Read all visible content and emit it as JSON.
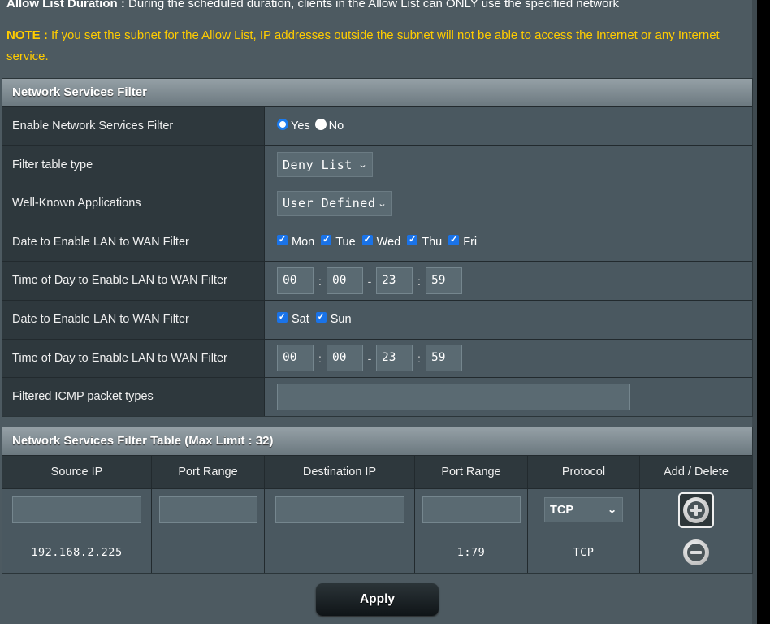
{
  "intro": {
    "allow_list_label": "Allow List Duration :",
    "allow_list_text": " During the scheduled duration, clients in the Allow List can ONLY use the specified network",
    "note_label": "NOTE :",
    "note_text": " If you set the subnet for the Allow List, IP addresses outside the subnet will not be able to access the Internet or any Internet service."
  },
  "filter": {
    "title": "Network Services Filter",
    "enable": {
      "label": "Enable Network Services Filter",
      "yes": "Yes",
      "no": "No",
      "selected": "Yes"
    },
    "table_type": {
      "label": "Filter table type",
      "value": "Deny List"
    },
    "well_known": {
      "label": "Well-Known Applications",
      "value": "User Defined"
    },
    "weekday_date": {
      "label": "Date to Enable LAN to WAN Filter",
      "days": [
        "Mon",
        "Tue",
        "Wed",
        "Thu",
        "Fri"
      ],
      "checked": [
        true,
        true,
        true,
        true,
        true
      ]
    },
    "weekday_time": {
      "label": "Time of Day to Enable LAN to WAN Filter",
      "start_h": "00",
      "start_m": "00",
      "end_h": "23",
      "end_m": "59"
    },
    "weekend_date": {
      "label": "Date to Enable LAN to WAN Filter",
      "days": [
        "Sat",
        "Sun"
      ],
      "checked": [
        true,
        true
      ]
    },
    "weekend_time": {
      "label": "Time of Day to Enable LAN to WAN Filter",
      "start_h": "00",
      "start_m": "00",
      "end_h": "23",
      "end_m": "59"
    },
    "icmp": {
      "label": "Filtered ICMP packet types",
      "value": ""
    }
  },
  "table": {
    "title": "Network Services Filter Table (Max Limit : 32)",
    "columns": [
      "Source IP",
      "Port Range",
      "Destination IP",
      "Port Range",
      "Protocol",
      "Add / Delete"
    ],
    "new_row": {
      "source_ip": "",
      "src_port": "",
      "dest_ip": "",
      "dst_port": "",
      "protocol": "TCP"
    },
    "rows": [
      {
        "source_ip": "192.168.2.225",
        "src_port": "",
        "dest_ip": "",
        "dst_port": "1:79",
        "protocol": "TCP"
      }
    ]
  },
  "apply_label": "Apply",
  "colors": {
    "accent": "#1a7bf0",
    "note": "#ffcc00",
    "background": "#4d5a61"
  }
}
